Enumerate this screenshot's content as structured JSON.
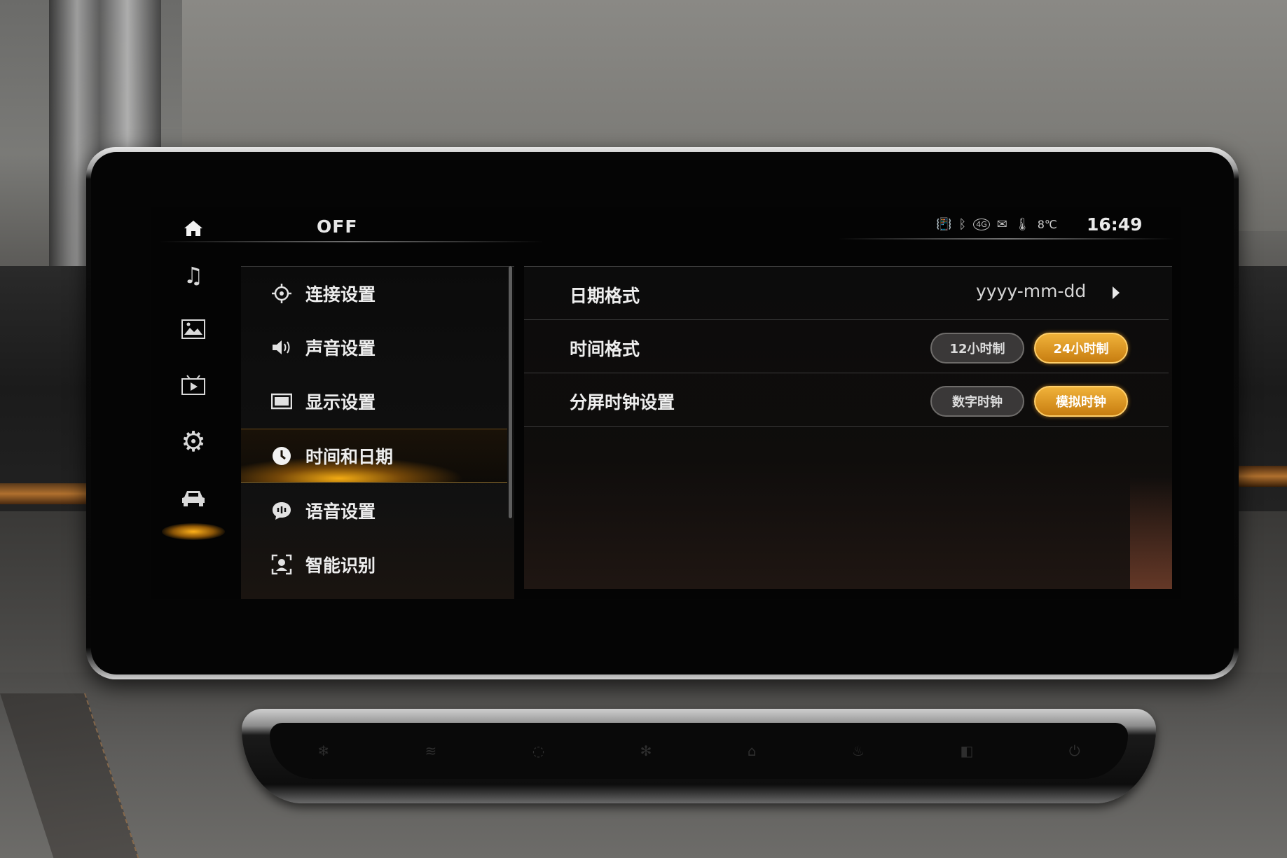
{
  "status_bar": {
    "off_label": "OFF",
    "temperature": "8℃",
    "time": "16:49",
    "network": "4G"
  },
  "rail": {
    "items": [
      {
        "name": "music-icon",
        "glyph": "♫"
      },
      {
        "name": "gallery-icon",
        "glyph": "🖼"
      },
      {
        "name": "video-icon",
        "glyph": "▶"
      },
      {
        "name": "settings-gear-icon",
        "glyph": "⚙"
      },
      {
        "name": "car-icon",
        "glyph": "🚘"
      }
    ],
    "active": "settings-gear-icon"
  },
  "menu": {
    "items": [
      {
        "label": "连接设置",
        "icon": "connect-icon"
      },
      {
        "label": "声音设置",
        "icon": "speaker-icon"
      },
      {
        "label": "显示设置",
        "icon": "display-icon"
      },
      {
        "label": "时间和日期",
        "icon": "clock-icon"
      },
      {
        "label": "语音设置",
        "icon": "voice-icon"
      },
      {
        "label": "智能识别",
        "icon": "face-scan-icon"
      }
    ],
    "active_index": 3
  },
  "panel": {
    "rows": [
      {
        "label": "日期格式",
        "value": "yyyy-mm-dd"
      },
      {
        "label": "时间格式",
        "options": [
          "12小时制",
          "24小时制"
        ],
        "selected": 1
      },
      {
        "label": "分屏时钟设置",
        "options": [
          "数字时钟",
          "模拟时钟"
        ],
        "selected": 1
      }
    ]
  },
  "colors": {
    "accent": "#e8a12a",
    "background": "#050505",
    "text": "#eeeeee"
  }
}
